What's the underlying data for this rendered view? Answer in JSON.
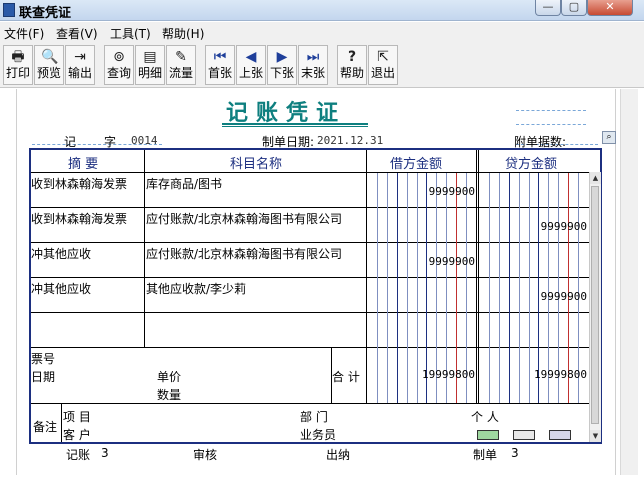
{
  "window": {
    "title": "联查凭证",
    "min": "—",
    "max": "▢",
    "close": "✕"
  },
  "menu": [
    "文件(F)",
    "查看(V)",
    "工具(T)",
    "帮助(H)"
  ],
  "toolbar": [
    {
      "label": "打印",
      "icon": "printer-icon",
      "glyph": "🖶"
    },
    {
      "label": "预览",
      "icon": "preview-icon",
      "glyph": "🔍"
    },
    {
      "label": "输出",
      "icon": "export-icon",
      "glyph": "⇥"
    },
    {
      "label": "查询",
      "icon": "binoculars-icon",
      "glyph": "⊚"
    },
    {
      "label": "明细",
      "icon": "detail-icon",
      "glyph": "▤"
    },
    {
      "label": "流量",
      "icon": "flow-icon",
      "glyph": "✎"
    },
    {
      "label": "首张",
      "icon": "first-icon",
      "glyph": "⏮"
    },
    {
      "label": "上张",
      "icon": "prev-icon",
      "glyph": "◀"
    },
    {
      "label": "下张",
      "icon": "next-icon",
      "glyph": "▶"
    },
    {
      "label": "末张",
      "icon": "last-icon",
      "glyph": "⏭"
    },
    {
      "label": "帮助",
      "icon": "help-icon",
      "glyph": "?"
    },
    {
      "label": "退出",
      "icon": "exit-icon",
      "glyph": "⇱"
    }
  ],
  "voucher": {
    "title": "记账凭证",
    "type_label": "记",
    "word_label": "字",
    "number": "0014",
    "date_label": "制单日期:",
    "date": "2021.12.31",
    "attachments_label": "附单据数:",
    "col_summary": "摘 要",
    "col_account": "科目名称",
    "col_debit": "借方金额",
    "col_credit": "贷方金额",
    "rows": [
      {
        "summary": "收到林森翰海发票",
        "account": "库存商品/图书",
        "debit": "9999900",
        "credit": ""
      },
      {
        "summary": "收到林森翰海发票",
        "account": "应付账款/北京林森翰海图书有限公司",
        "debit": "",
        "credit": "9999900"
      },
      {
        "summary": "冲其他应收",
        "account": "应付账款/北京林森翰海图书有限公司",
        "debit": "9999900",
        "credit": ""
      },
      {
        "summary": "冲其他应收",
        "account": "其他应收款/李少莉",
        "debit": "",
        "credit": "9999900"
      },
      {
        "summary": "",
        "account": "",
        "debit": "",
        "credit": ""
      }
    ],
    "ticket_label": "票号",
    "date2_label": "日期",
    "price_label": "单价",
    "qty_label": "数量",
    "total_label": "合 计",
    "total_debit": "19999800",
    "total_credit": "19999800",
    "remark_label": "备注",
    "project_label": "项  目",
    "customer_label": "客  户",
    "dept_label": "部  门",
    "person_label": "个  人",
    "salesman_label": "业务员"
  },
  "footer": {
    "bookkeeper_label": "记账",
    "bookkeeper": "3",
    "auditor_label": "审核",
    "cashier_label": "出纳",
    "maker_label": "制单",
    "maker": "3"
  }
}
